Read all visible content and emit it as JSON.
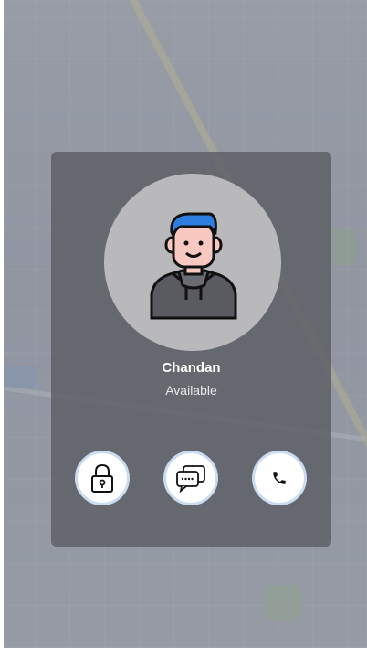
{
  "contact": {
    "name": "Chandan",
    "status": "Available"
  },
  "actions": [
    {
      "icon": "lock-icon"
    },
    {
      "icon": "chat-icon"
    },
    {
      "icon": "phone-icon"
    }
  ],
  "colors": {
    "card": "#5c5e64",
    "avatar_bg": "#b9b9bb",
    "hair": "#2e7de0",
    "skin": "#f8c9c0",
    "hoodie": "#5a5b60",
    "button_ring": "#c8dcf2"
  }
}
